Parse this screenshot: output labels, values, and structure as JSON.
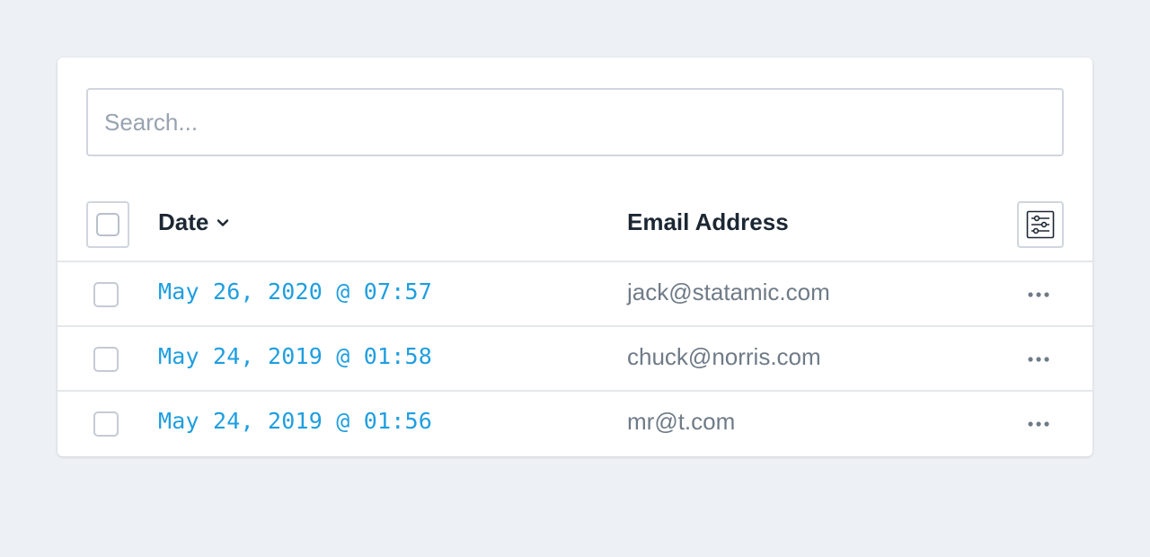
{
  "search": {
    "placeholder": "Search...",
    "value": ""
  },
  "table": {
    "columns": {
      "date": "Date",
      "email": "Email Address"
    },
    "sort_icon": "chevron-down-icon",
    "settings_icon": "sliders-icon",
    "rows": [
      {
        "date": "May 26, 2020 @ 07:57",
        "email": "jack@statamic.com"
      },
      {
        "date": "May 24, 2019 @ 01:58",
        "email": "chuck@norris.com"
      },
      {
        "date": "May 24, 2019 @ 01:56",
        "email": "mr@t.com"
      }
    ]
  },
  "colors": {
    "link": "#1f9ee0",
    "heading": "#1c2733",
    "muted": "#6f7b87",
    "border": "#cfd6de",
    "background": "#edf0f4"
  }
}
